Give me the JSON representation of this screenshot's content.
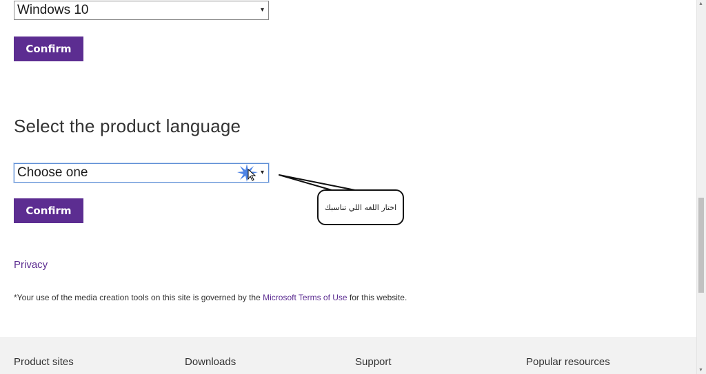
{
  "os_select": {
    "value": "Windows 10",
    "arrow": "▾"
  },
  "confirm_button_1": {
    "label": "Confirm"
  },
  "language_section": {
    "heading": "Select the product language",
    "select_value": "Choose one",
    "arrow": "▾",
    "confirm_label": "Confirm"
  },
  "callout": {
    "text": "اختار اللغه اللي تناسبك"
  },
  "links": {
    "privacy": "Privacy",
    "terms_prefix": "*Your use of the media creation tools on this site is governed by the ",
    "terms_link": "Microsoft Terms of Use",
    "terms_suffix": " for this website."
  },
  "footer": {
    "col1": "Product sites",
    "col2": "Downloads",
    "col3": "Support",
    "col4": "Popular resources"
  },
  "colors": {
    "accent": "#5c2d91",
    "footer_bg": "#f2f2f2"
  }
}
